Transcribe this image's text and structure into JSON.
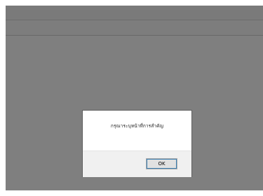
{
  "dialog": {
    "message": "กรุณาระบุหน้าที่การสำคัญ",
    "ok_label": "OK"
  },
  "colors": {
    "overlay": "#7f7f7f",
    "dialog_body": "#ffffff",
    "dialog_footer": "#f0f0f0",
    "button_focus": "#3c7fb1"
  }
}
